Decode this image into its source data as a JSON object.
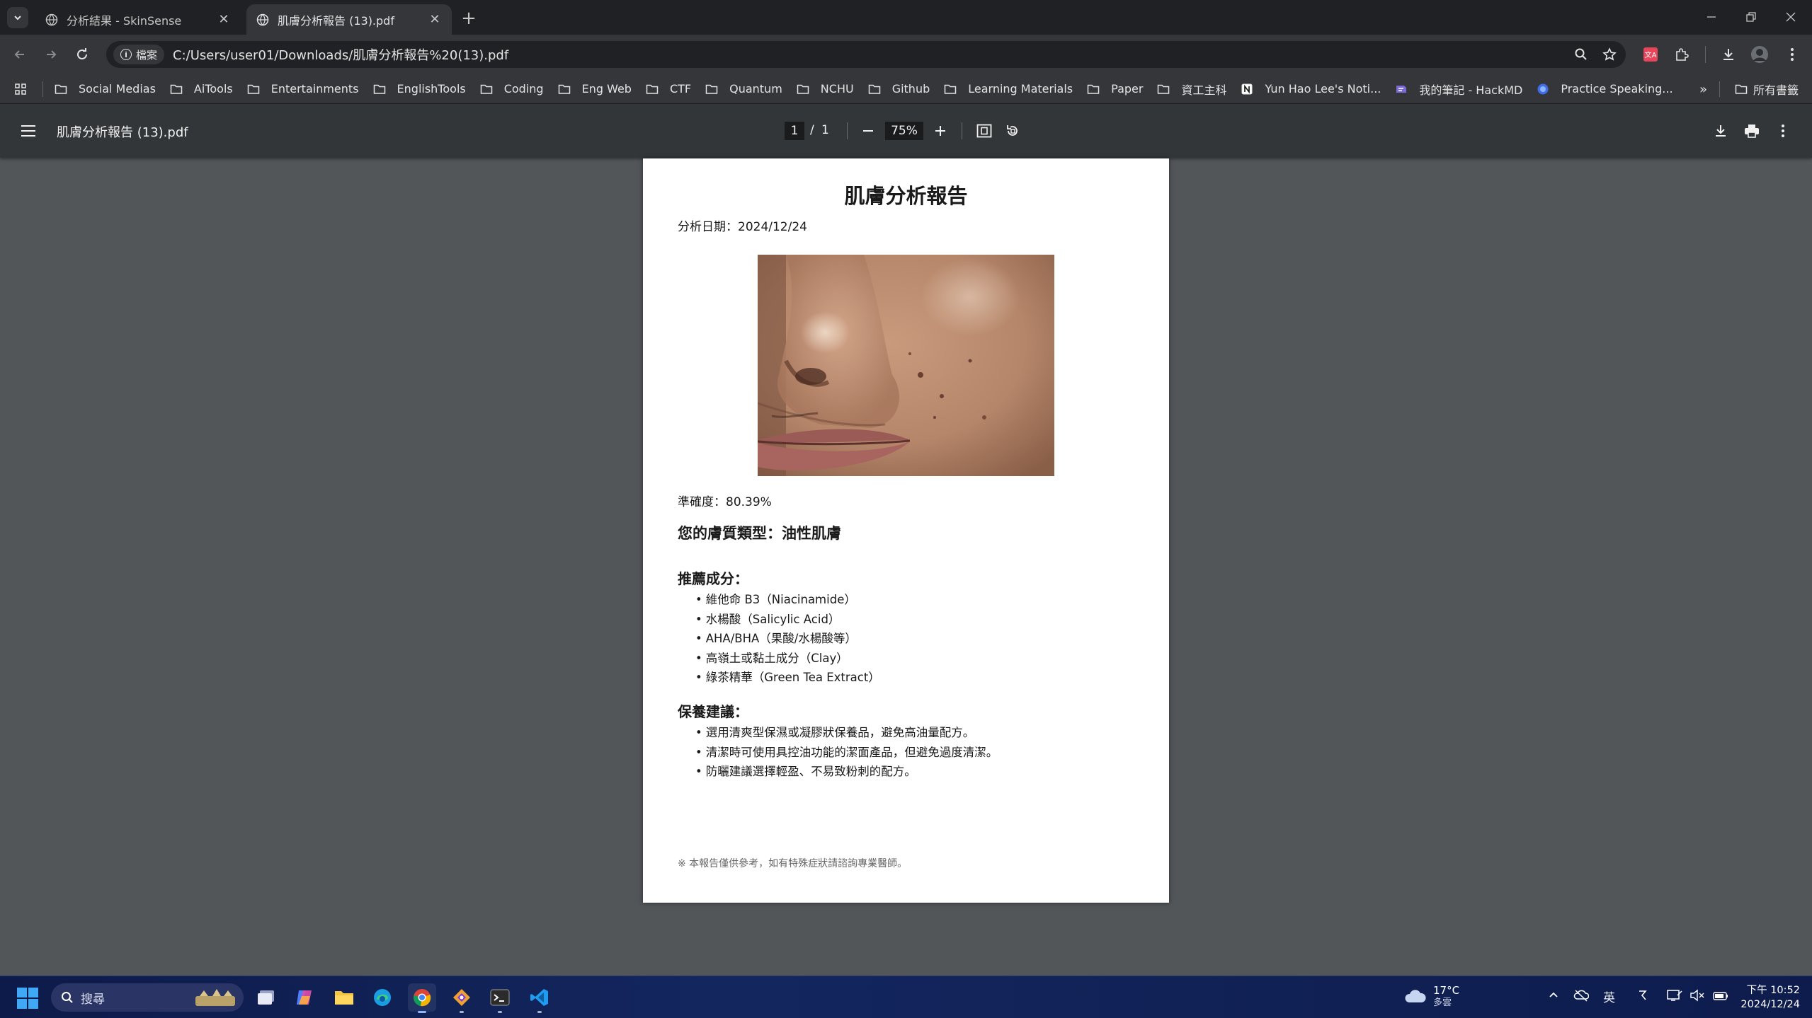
{
  "browser": {
    "tabs": [
      {
        "title": "分析結果 - SkinSense",
        "active": false
      },
      {
        "title": "肌膚分析報告 (13).pdf",
        "active": true
      }
    ],
    "omnibox": {
      "chip_label": "檔案",
      "url": "C:/Users/user01/Downloads/肌膚分析報告%20(13).pdf"
    },
    "bookmarks": [
      {
        "label": "Social Medias",
        "icon": "folder-icon"
      },
      {
        "label": "AiTools",
        "icon": "folder-icon"
      },
      {
        "label": "Entertainments",
        "icon": "folder-icon"
      },
      {
        "label": "EnglishTools",
        "icon": "folder-icon"
      },
      {
        "label": "Coding",
        "icon": "folder-icon"
      },
      {
        "label": "Eng Web",
        "icon": "folder-icon"
      },
      {
        "label": "CTF",
        "icon": "folder-icon"
      },
      {
        "label": "Quantum",
        "icon": "folder-icon"
      },
      {
        "label": "NCHU",
        "icon": "folder-icon"
      },
      {
        "label": "Github",
        "icon": "folder-icon"
      },
      {
        "label": "Learning Materials",
        "icon": "folder-icon"
      },
      {
        "label": "Paper",
        "icon": "folder-icon"
      },
      {
        "label": "資工主科",
        "icon": "folder-icon"
      },
      {
        "label": "Yun Hao Lee's Noti...",
        "icon": "notion-icon"
      },
      {
        "label": "我的筆記 - HackMD",
        "icon": "hackmd-icon"
      },
      {
        "label": "Practice Speaking...",
        "icon": "globe-icon"
      }
    ],
    "all_bookmarks_label": "所有書籤"
  },
  "pdf_viewer": {
    "file_title": "肌膚分析報告 (13).pdf",
    "current_page": "1",
    "page_separator": "/",
    "total_pages": "1",
    "zoom": "75%"
  },
  "document": {
    "title": "肌膚分析報告",
    "date_line": "分析日期：2024/12/24",
    "accuracy_line": "準確度：80.39%",
    "skin_type_line": "您的膚質類型：油性肌膚",
    "ingredients_heading": "推薦成分：",
    "ingredients": [
      "維他命 B3（Niacinamide）",
      "水楊酸（Salicylic Acid）",
      "AHA/BHA（果酸/水楊酸等）",
      "高嶺土或黏土成分（Clay）",
      "綠茶精華（Green Tea Extract）"
    ],
    "care_heading": "保養建議：",
    "care_tips": [
      "選用清爽型保濕或凝膠狀保養品，避免高油量配方。",
      "清潔時可使用具控油功能的潔面產品，但避免過度清潔。",
      "防曬建議選擇輕盈、不易致粉刺的配方。"
    ],
    "footer_note": "※ 本報告僅供參考，如有特殊症狀請諮詢專業醫師。"
  },
  "taskbar": {
    "search_placeholder": "搜尋",
    "weather_temp": "17°C",
    "weather_desc": "多雲",
    "ime": "英",
    "time": "下午 10:52",
    "date": "2024/12/24"
  },
  "colors": {
    "tab_bar": "#202124",
    "toolbar": "#35363a",
    "pdf_background": "#525659",
    "pdf_toolbar": "#323639"
  }
}
